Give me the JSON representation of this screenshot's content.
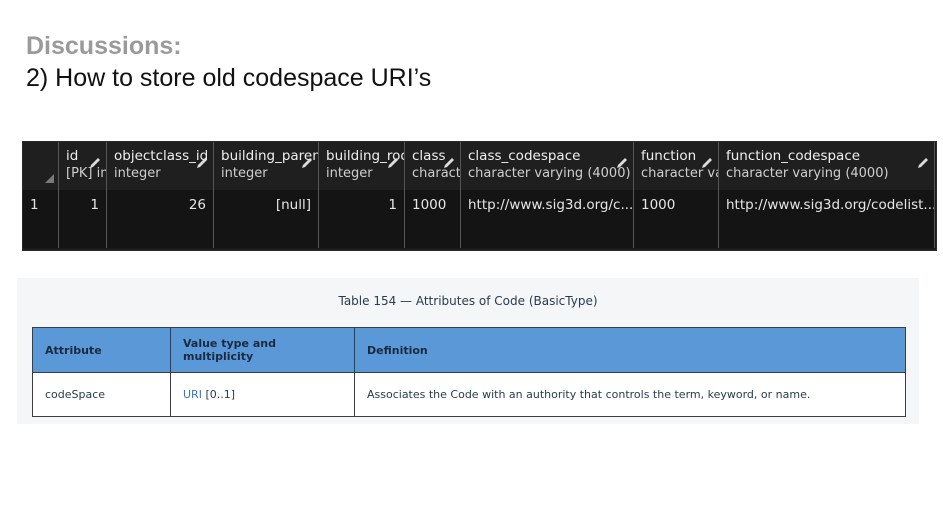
{
  "slide": {
    "heading": "Discussions:",
    "subtitle": "2) How to store old codespace URI’s"
  },
  "db_grid": {
    "columns": [
      {
        "name": "id",
        "type": "[PK] in"
      },
      {
        "name": "objectclass_id",
        "type": "integer"
      },
      {
        "name": "building_parent",
        "type": "integer"
      },
      {
        "name": "building_roo",
        "type": "integer"
      },
      {
        "name": "class",
        "type": "charact"
      },
      {
        "name": "class_codespace",
        "type": "character varying (4000)"
      },
      {
        "name": "function",
        "type": "character va"
      },
      {
        "name": "function_codespace",
        "type": "character varying (4000)"
      }
    ],
    "rows": [
      {
        "row_number": "1",
        "cells": [
          "1",
          "26",
          "[null]",
          "1",
          "1000",
          "http://www.sig3d.org/c...",
          "1000",
          "http://www.sig3d.org/codelist..."
        ]
      }
    ]
  },
  "spec_table": {
    "caption": "Table 154 — Attributes of Code (BasicType)",
    "headers": [
      "Attribute",
      "Value type and multiplicity",
      "Definition"
    ],
    "rows": [
      {
        "attribute": "codeSpace",
        "value_type_link": "URI",
        "multiplicity": " [0..1]",
        "definition": "Associates the Code with an authority that controls the term, keyword, or name."
      }
    ]
  }
}
